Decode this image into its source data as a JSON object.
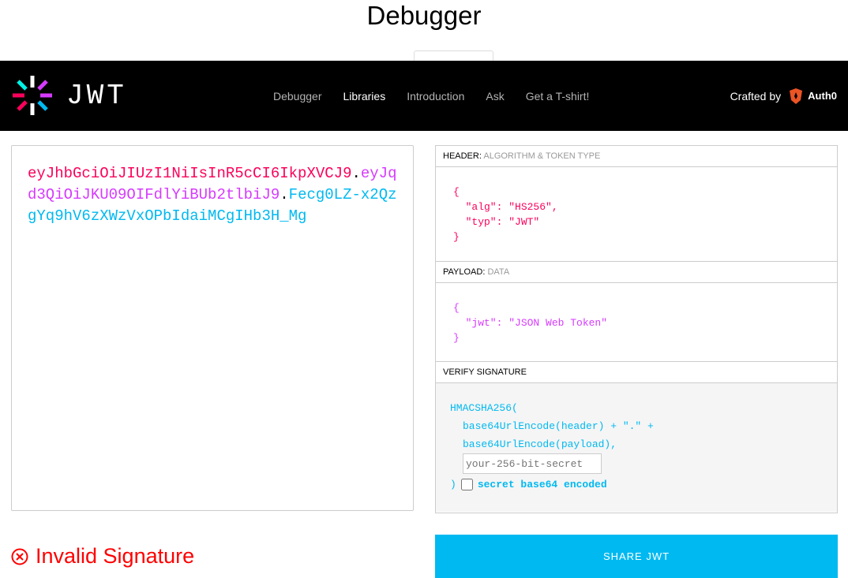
{
  "page_title": "Debugger",
  "nav": {
    "logo_text": "JWT",
    "links": [
      {
        "label": "Debugger"
      },
      {
        "label": "Libraries"
      },
      {
        "label": "Introduction"
      },
      {
        "label": "Ask"
      },
      {
        "label": "Get a T-shirt!"
      }
    ],
    "crafted_by": "Crafted by",
    "brand": "Auth0"
  },
  "encoded": {
    "header_part": "eyJhbGciOiJIUzI1NiIsInR5cCI6IkpXVCJ9",
    "payload_part": "eyJqd3QiOiJKU09OIFdlYiBUb2tlbiJ9",
    "signature_part": "Fecg0LZ-x2QzgYq9hV6zXWzVxOPbIdaiMCgIHb3H_Mg",
    "dot": "."
  },
  "decoded": {
    "header": {
      "title": "HEADER:",
      "subtitle": "ALGORITHM & TOKEN TYPE",
      "lines": [
        "{",
        "  \"alg\": \"HS256\",",
        "  \"typ\": \"JWT\"",
        "}"
      ]
    },
    "payload": {
      "title": "PAYLOAD:",
      "subtitle": "DATA",
      "lines": [
        "{",
        "  \"jwt\": \"JSON Web Token\"",
        "}"
      ]
    },
    "signature": {
      "title": "VERIFY SIGNATURE",
      "line1": "HMACSHA256(",
      "line2": "base64UrlEncode(header) + \".\" +",
      "line3": "base64UrlEncode(payload),",
      "secret_placeholder": "your-256-bit-secret",
      "close": ")",
      "checkbox_label": "secret base64 encoded"
    }
  },
  "status": {
    "text": "Invalid Signature",
    "color": "#ff0000"
  },
  "share_button": "SHARE JWT",
  "colors": {
    "header": "#fb015b",
    "payload": "#d63aff",
    "signature": "#00b9f1",
    "accent": "#00b9f1"
  }
}
